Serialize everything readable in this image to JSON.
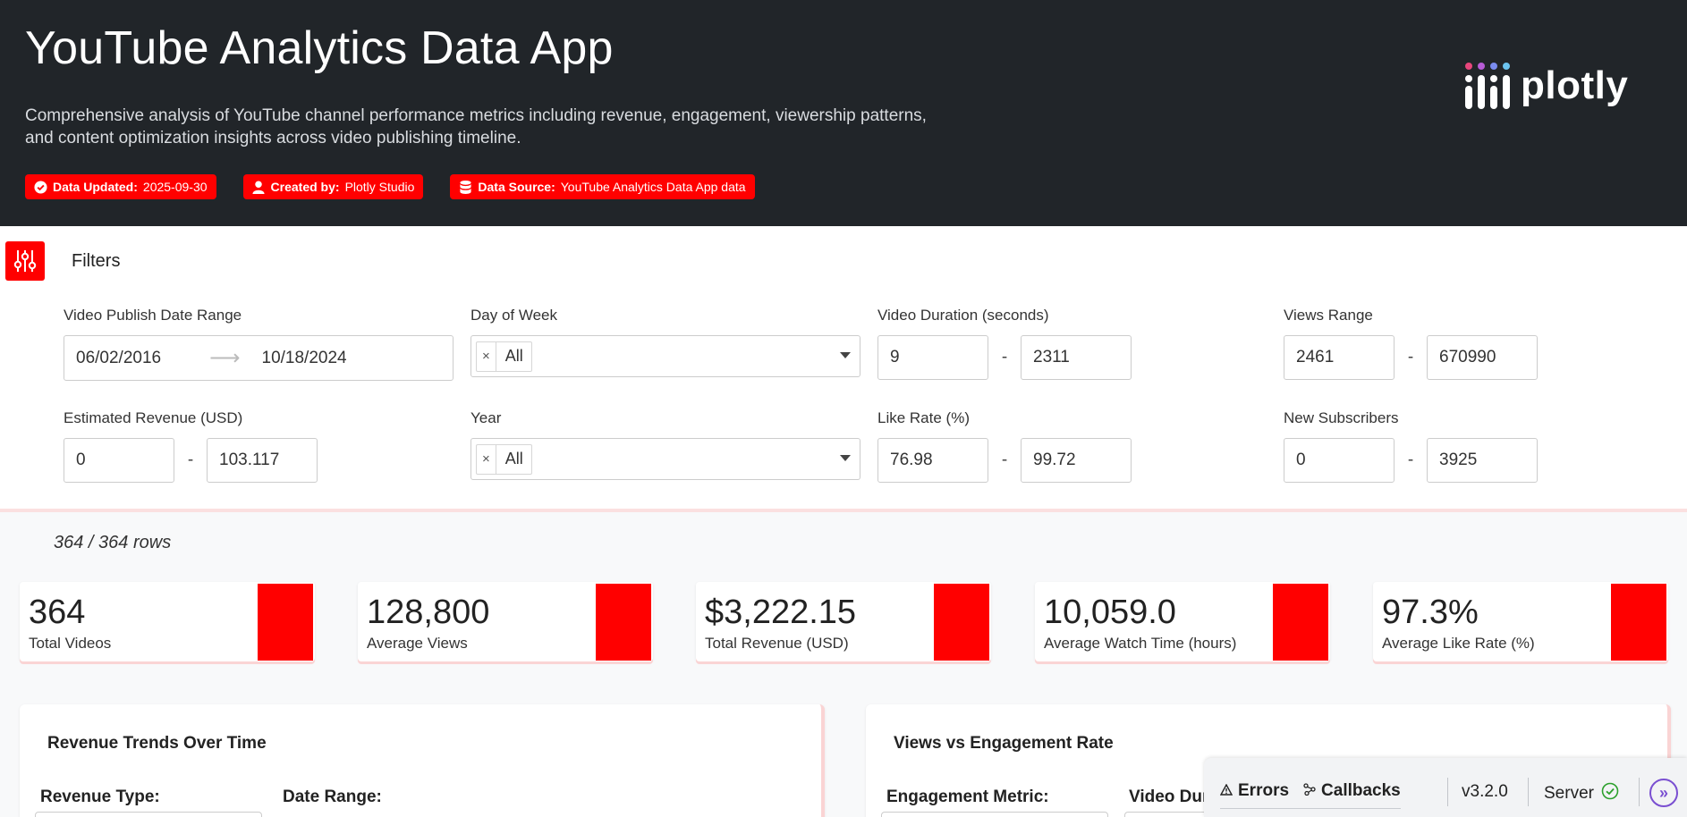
{
  "header": {
    "title": "YouTube Analytics Data App",
    "description": "Comprehensive analysis of YouTube channel performance metrics including revenue, engagement, viewership patterns, and content optimization insights across video publishing timeline.",
    "badges": [
      {
        "key": "Data Updated:",
        "value": "2025-09-30",
        "icon": "check-circle-icon"
      },
      {
        "key": "Created by:",
        "value": "Plotly Studio",
        "icon": "user-icon"
      },
      {
        "key": "Data Source:",
        "value": "YouTube Analytics Data App data",
        "icon": "database-icon"
      }
    ],
    "logo_text": "plotly"
  },
  "filters": {
    "title": "Filters",
    "publish_date": {
      "label": "Video Publish Date Range",
      "start": "06/02/2016",
      "end": "10/18/2024"
    },
    "day_of_week": {
      "label": "Day of Week",
      "chip": "All",
      "chip_remove": "×"
    },
    "duration": {
      "label": "Video Duration (seconds)",
      "min": "9",
      "max": "2311"
    },
    "views": {
      "label": "Views Range",
      "min": "2461",
      "max": "670990"
    },
    "revenue": {
      "label": "Estimated Revenue (USD)",
      "min": "0",
      "max": "103.117"
    },
    "year": {
      "label": "Year",
      "chip": "All",
      "chip_remove": "×"
    },
    "like_rate": {
      "label": "Like Rate (%)",
      "min": "76.98",
      "max": "99.72"
    },
    "subscribers": {
      "label": "New Subscribers",
      "min": "0",
      "max": "3925"
    },
    "separator": "-"
  },
  "row_count": "364 / 364 rows",
  "kpis": [
    {
      "value": "364",
      "label": "Total Videos"
    },
    {
      "value": "128,800",
      "label": "Average Views"
    },
    {
      "value": "$3,222.15",
      "label": "Total Revenue (USD)"
    },
    {
      "value": "10,059.0",
      "label": "Average Watch Time (hours)"
    },
    {
      "value": "97.3%",
      "label": "Average Like Rate (%)"
    }
  ],
  "cards": {
    "revenue_trends": {
      "title": "Revenue Trends Over Time",
      "control1": "Revenue Type:",
      "control2": "Date Range:"
    },
    "views_engagement": {
      "title": "Views vs Engagement Rate",
      "control1": "Engagement Metric:",
      "control2": "Video Dur"
    }
  },
  "devtools": {
    "errors": "Errors",
    "callbacks": "Callbacks",
    "version": "v3.2.0",
    "server": "Server",
    "toggle": "»"
  },
  "colors": {
    "brand": "#ff0000",
    "header_bg": "#212529",
    "devtools_accent": "#7a4fd1"
  }
}
